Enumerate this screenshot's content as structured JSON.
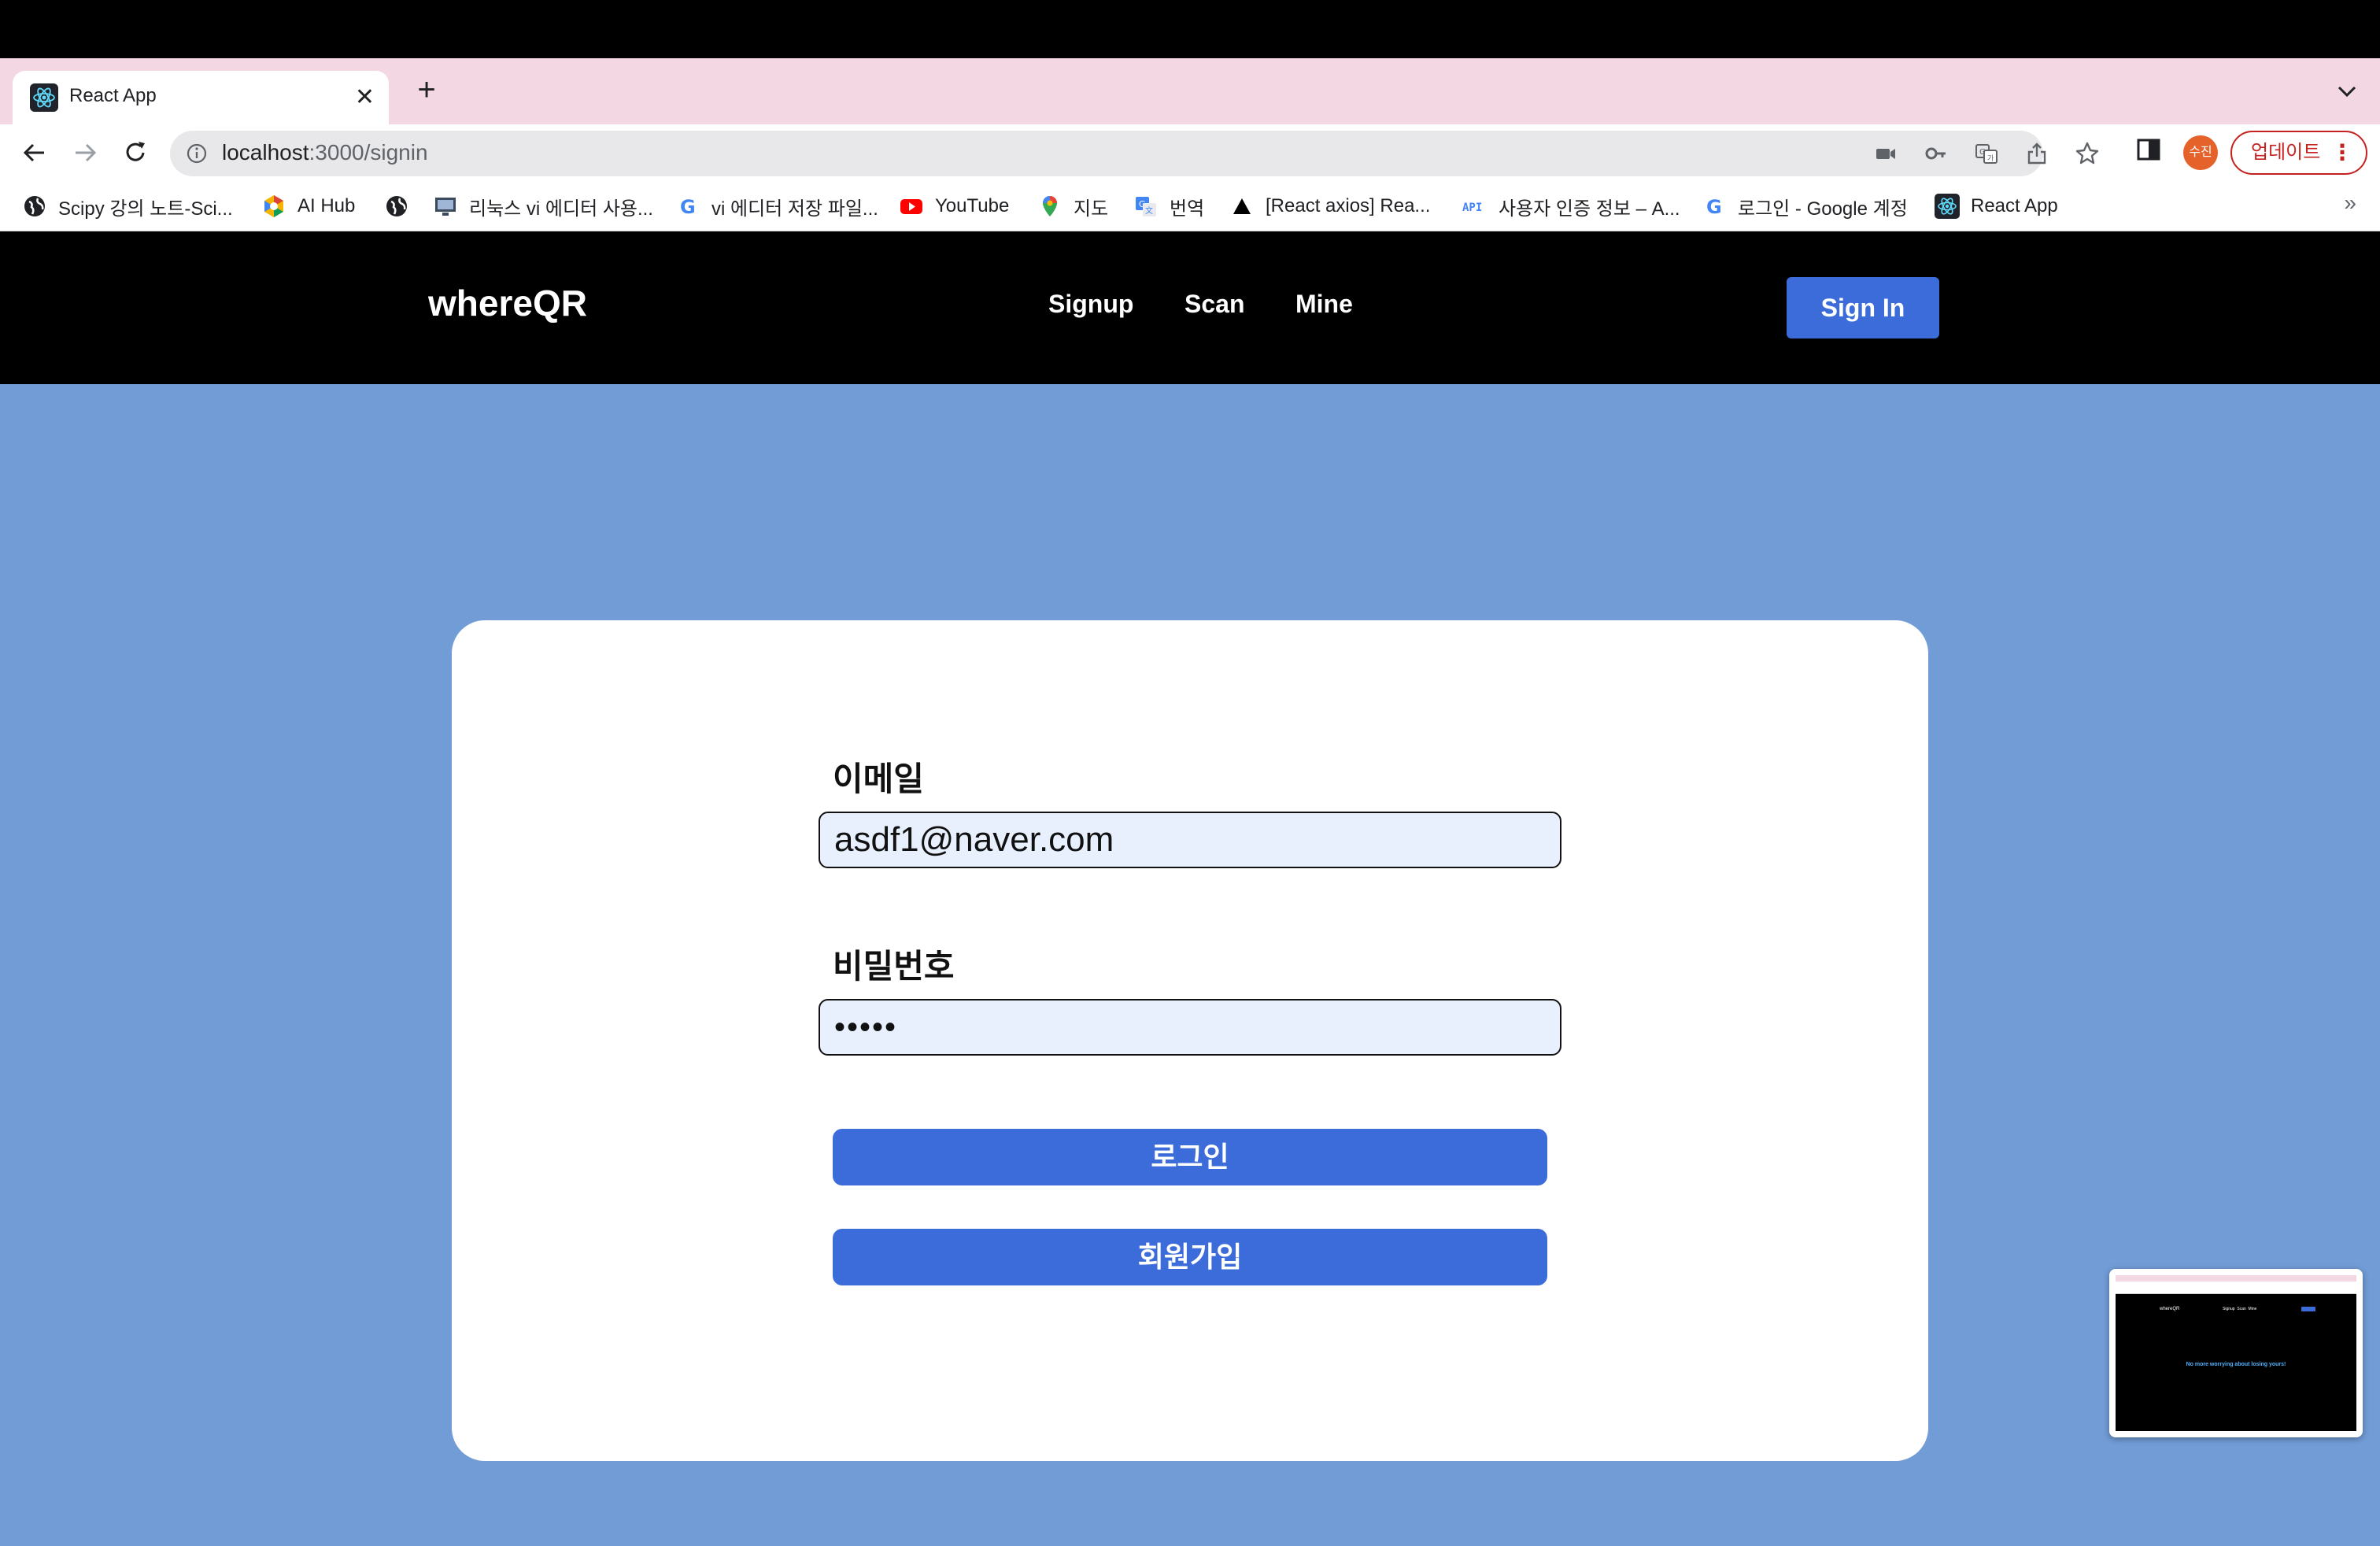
{
  "browser": {
    "tab_title": "React App",
    "tab_close": "✕",
    "new_tab": "+",
    "url_host": "localhost",
    "url_path": ":3000/signin",
    "avatar_initials": "수진",
    "update_label": "업데이트",
    "update_menu": "⋮"
  },
  "bookmarks": [
    {
      "label": "Scipy 강의 노트-Sci...",
      "icon": "globe-icon"
    },
    {
      "label": "AI Hub",
      "icon": "aihub-icon"
    },
    {
      "label": "",
      "icon": "globe-icon"
    },
    {
      "label": "리눅스 vi 에디터 사용...",
      "icon": "monitor-icon"
    },
    {
      "label": "vi 에디터 저장 파일...",
      "icon": "google-icon"
    },
    {
      "label": "YouTube",
      "icon": "youtube-icon"
    },
    {
      "label": "지도",
      "icon": "maps-icon"
    },
    {
      "label": "번역",
      "icon": "translate-icon"
    },
    {
      "label": "[React axios] Rea...",
      "icon": "triangle-icon"
    },
    {
      "label": "사용자 인증 정보 – A...",
      "icon": "api-icon"
    },
    {
      "label": "로그인 - Google 계정",
      "icon": "google-icon"
    },
    {
      "label": "React App",
      "icon": "react-icon"
    }
  ],
  "bookmarks_more": "»",
  "header": {
    "brand": "whereQR",
    "nav": [
      "Signup",
      "Scan",
      "Mine"
    ],
    "signin_label": "Sign In"
  },
  "form": {
    "email_label": "이메일",
    "email_value": "asdf1@naver.com",
    "password_label": "비밀번호",
    "password_value": "•••••",
    "login_label": "로그인",
    "signup_label": "회원가입"
  },
  "thumbnail": {
    "text": "No more worrying about losing yours!"
  },
  "colors": {
    "tabbar": "#f3d7e3",
    "main_bg": "#719cd6",
    "accent": "#3c6cd9",
    "input_bg": "#e8f0fe"
  }
}
